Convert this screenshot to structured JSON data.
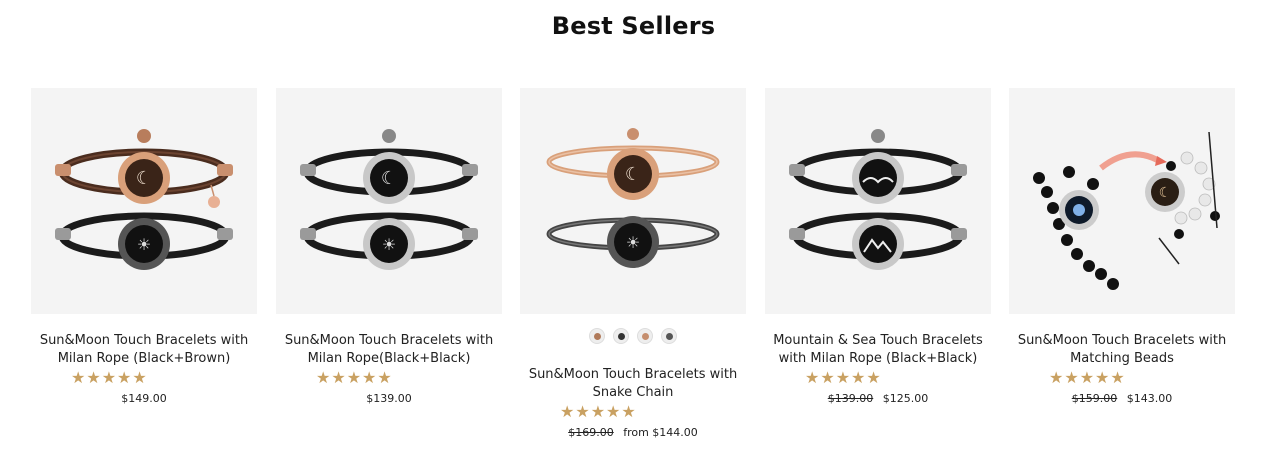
{
  "section": {
    "title": "Best Sellers"
  },
  "colors": {
    "star": "#c9a162",
    "image_bg": "#f4f4f4",
    "rose_gold": "#d9a07a",
    "black": "#1b1b1b",
    "silver": "#bfbfbf"
  },
  "products": [
    {
      "name": "Sun&Moon Touch Bracelets with Milan Rope (Black+Brown)",
      "rating_stars": "★★★★★",
      "rating": 5,
      "old_price": "",
      "price": "$149.00",
      "image_icon": "bracelet-pair-brown-black-icon"
    },
    {
      "name": "Sun&Moon Touch Bracelets with Milan Rope(Black+Black)",
      "rating_stars": "★★★★★",
      "rating": 5,
      "old_price": "",
      "price": "$139.00",
      "image_icon": "bracelet-pair-black-black-icon"
    },
    {
      "name": "Sun&Moon Touch Bracelets with Snake Chain",
      "rating_stars": "★★★★★",
      "rating": 5,
      "old_price": "$169.00",
      "price": "from $144.00",
      "image_icon": "bracelet-pair-snake-chain-icon",
      "swatch_count": 4
    },
    {
      "name": "Mountain & Sea Touch Bracelets with Milan Rope (Black+Black)",
      "rating_stars": "★★★★★",
      "rating": 5,
      "old_price": "$139.00",
      "price": "$125.00",
      "image_icon": "bracelet-pair-mountain-sea-icon"
    },
    {
      "name": "Sun&Moon Touch Bracelets with Matching Beads",
      "rating_stars": "★★★★★",
      "rating": 5,
      "old_price": "$159.00",
      "price": "$143.00",
      "image_icon": "bracelet-pair-beads-icon"
    }
  ]
}
